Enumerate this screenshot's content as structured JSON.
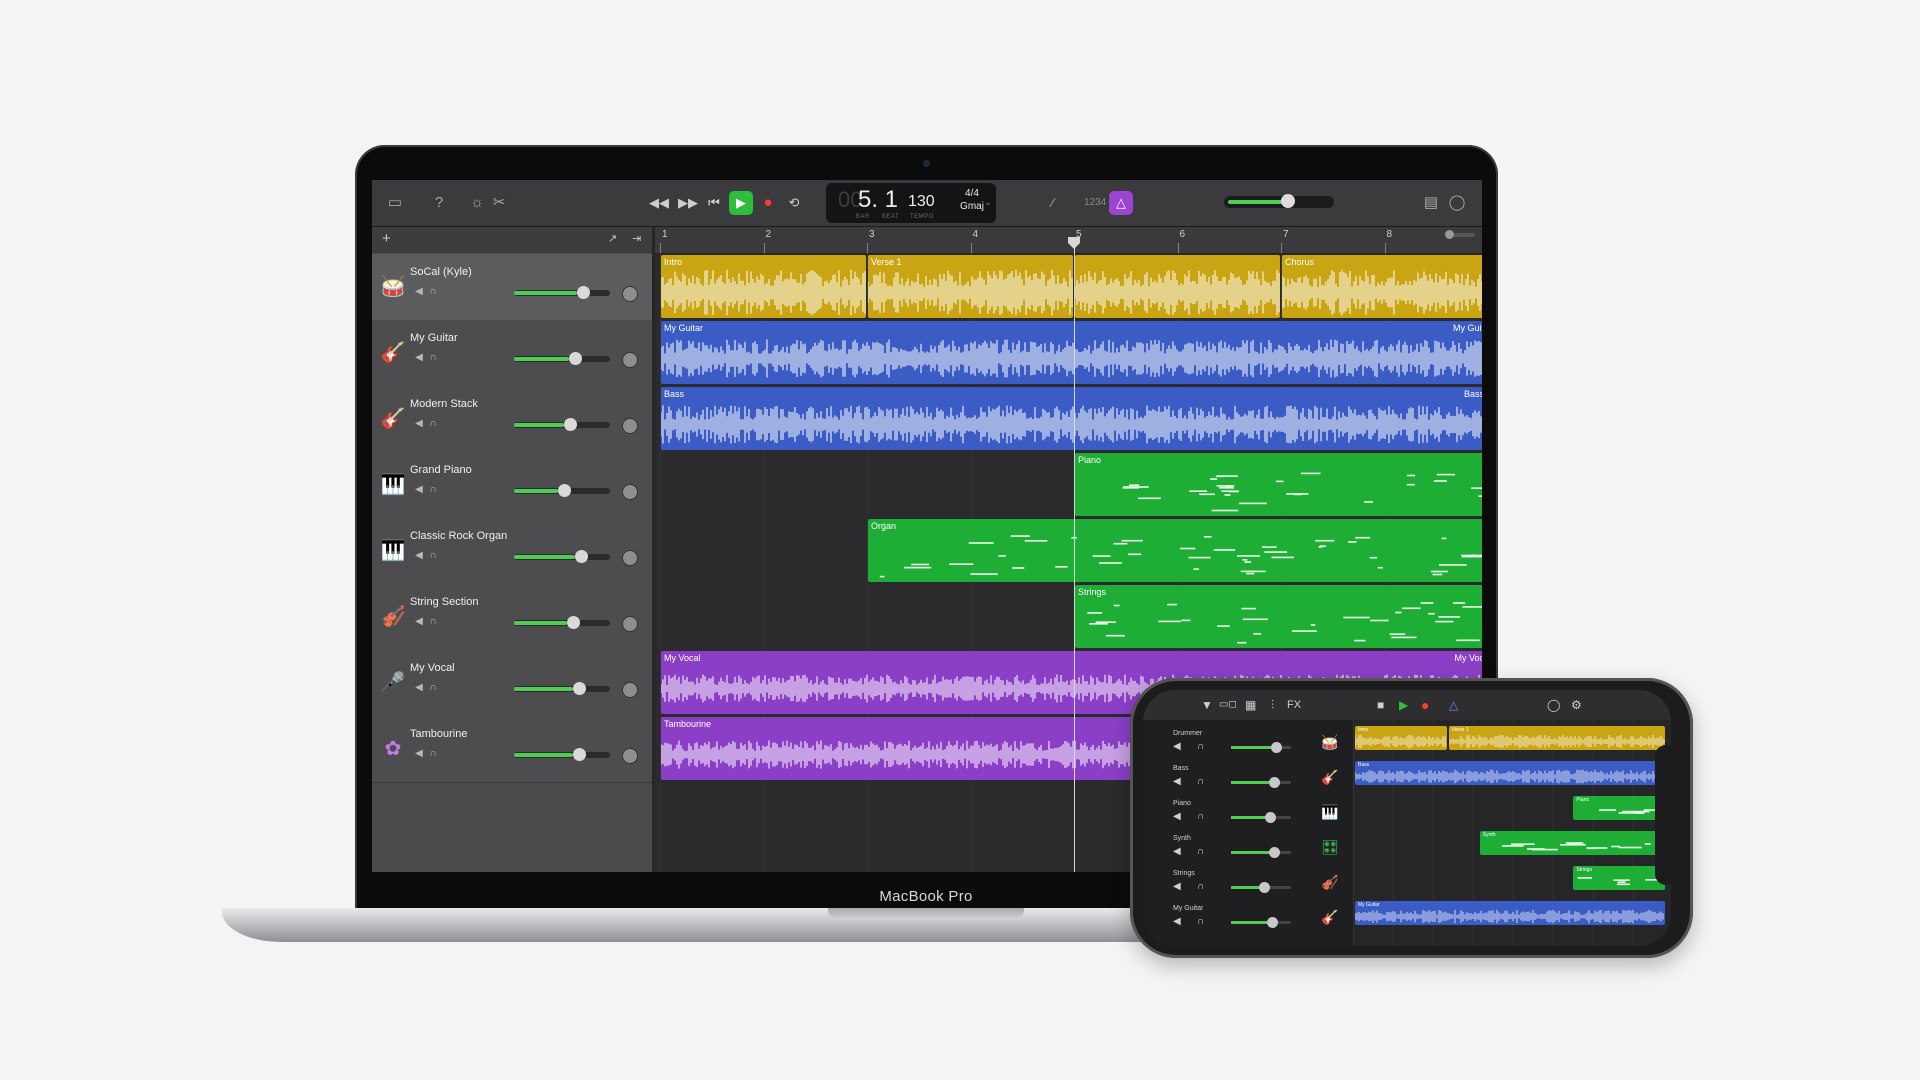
{
  "device_label": "MacBook Pro",
  "toolbar": {
    "lcd": {
      "bar": "00",
      "beat": "5. 1",
      "bar_caption": "BAR",
      "beat_caption": "BEAT",
      "tempo": "130",
      "tempo_caption": "TEMPO",
      "time_signature": "4/4",
      "key": "Gmaj"
    },
    "count_in": "1234",
    "master_volume": 0.6
  },
  "ruler": [
    "1",
    "2",
    "3",
    "4",
    "5",
    "6",
    "7",
    "8"
  ],
  "colors": {
    "drums": "#c9a413",
    "blue": "#3b5cc4",
    "green": "#1fae35",
    "purple": "#8b3fc6"
  },
  "tracks": [
    {
      "name": "SoCal (Kyle)",
      "icon": "drum-kit-icon",
      "volume": 0.72,
      "selected": true
    },
    {
      "name": "My Guitar",
      "icon": "guitar-icon",
      "volume": 0.64,
      "selected": false
    },
    {
      "name": "Modern Stack",
      "icon": "bass-guitar-icon",
      "volume": 0.58,
      "selected": false
    },
    {
      "name": "Grand Piano",
      "icon": "piano-icon",
      "volume": 0.52,
      "selected": false
    },
    {
      "name": "Classic Rock Organ",
      "icon": "organ-icon",
      "volume": 0.7,
      "selected": false
    },
    {
      "name": "String Section",
      "icon": "strings-icon",
      "volume": 0.61,
      "selected": false
    },
    {
      "name": "My Vocal",
      "icon": "microphone-icon",
      "volume": 0.68,
      "selected": false
    },
    {
      "name": "Tambourine",
      "icon": "tambourine-icon",
      "volume": 0.68,
      "selected": false
    }
  ],
  "regions": [
    {
      "track": 0,
      "name": "Intro",
      "start": 1,
      "end": 3,
      "kind": "drums"
    },
    {
      "track": 0,
      "name": "Verse 1",
      "start": 3,
      "end": 5,
      "kind": "drums"
    },
    {
      "track": 0,
      "name": "",
      "start": 5,
      "end": 7,
      "kind": "drums"
    },
    {
      "track": 0,
      "name": "Chorus",
      "start": 7,
      "end": 9,
      "kind": "drums"
    },
    {
      "track": 1,
      "name": "My Guitar",
      "name_right": "My Guit",
      "start": 1,
      "end": 9,
      "kind": "blue"
    },
    {
      "track": 2,
      "name": "Bass",
      "name_right": "Bass",
      "start": 1,
      "end": 9,
      "kind": "blue"
    },
    {
      "track": 3,
      "name": "Piano",
      "start": 5,
      "end": 9,
      "kind": "green"
    },
    {
      "track": 4,
      "name": "Organ",
      "start": 3,
      "end": 9,
      "kind": "green"
    },
    {
      "track": 5,
      "name": "Strings",
      "start": 5,
      "end": 9,
      "kind": "green"
    },
    {
      "track": 6,
      "name": "My Vocal",
      "name_right": "My Voc",
      "start": 1,
      "end": 9,
      "kind": "purple"
    },
    {
      "track": 7,
      "name": "Tambourine",
      "start": 1,
      "end": 9,
      "kind": "purple"
    }
  ],
  "playhead_bar": 5,
  "phone": {
    "fx_label": "FX",
    "tracks": [
      {
        "name": "Drummer",
        "volume": 0.75,
        "icon": "drum-kit-icon"
      },
      {
        "name": "Bass",
        "volume": 0.72,
        "icon": "bass-guitar-icon"
      },
      {
        "name": "Piano",
        "volume": 0.65,
        "icon": "piano-icon"
      },
      {
        "name": "Synth",
        "volume": 0.72,
        "icon": "synth-icon"
      },
      {
        "name": "Strings",
        "volume": 0.55,
        "icon": "strings-icon"
      },
      {
        "name": "My Guitar",
        "volume": 0.68,
        "icon": "guitar-icon"
      }
    ],
    "regions": [
      {
        "track": 0,
        "name": "Intro",
        "start": 0.0,
        "end": 0.3,
        "kind": "drums"
      },
      {
        "track": 0,
        "name": "Verse 1",
        "start": 0.3,
        "end": 1.0,
        "kind": "drums"
      },
      {
        "track": 1,
        "name": "Bass",
        "start": 0.0,
        "end": 1.0,
        "kind": "blue"
      },
      {
        "track": 2,
        "name": "Piano",
        "start": 0.7,
        "end": 1.0,
        "kind": "green"
      },
      {
        "track": 3,
        "name": "Synth",
        "start": 0.4,
        "end": 1.0,
        "kind": "green"
      },
      {
        "track": 4,
        "name": "Strings",
        "start": 0.7,
        "end": 1.0,
        "kind": "green"
      },
      {
        "track": 5,
        "name": "My Guitar",
        "start": 0.0,
        "end": 1.0,
        "kind": "blue"
      }
    ]
  }
}
